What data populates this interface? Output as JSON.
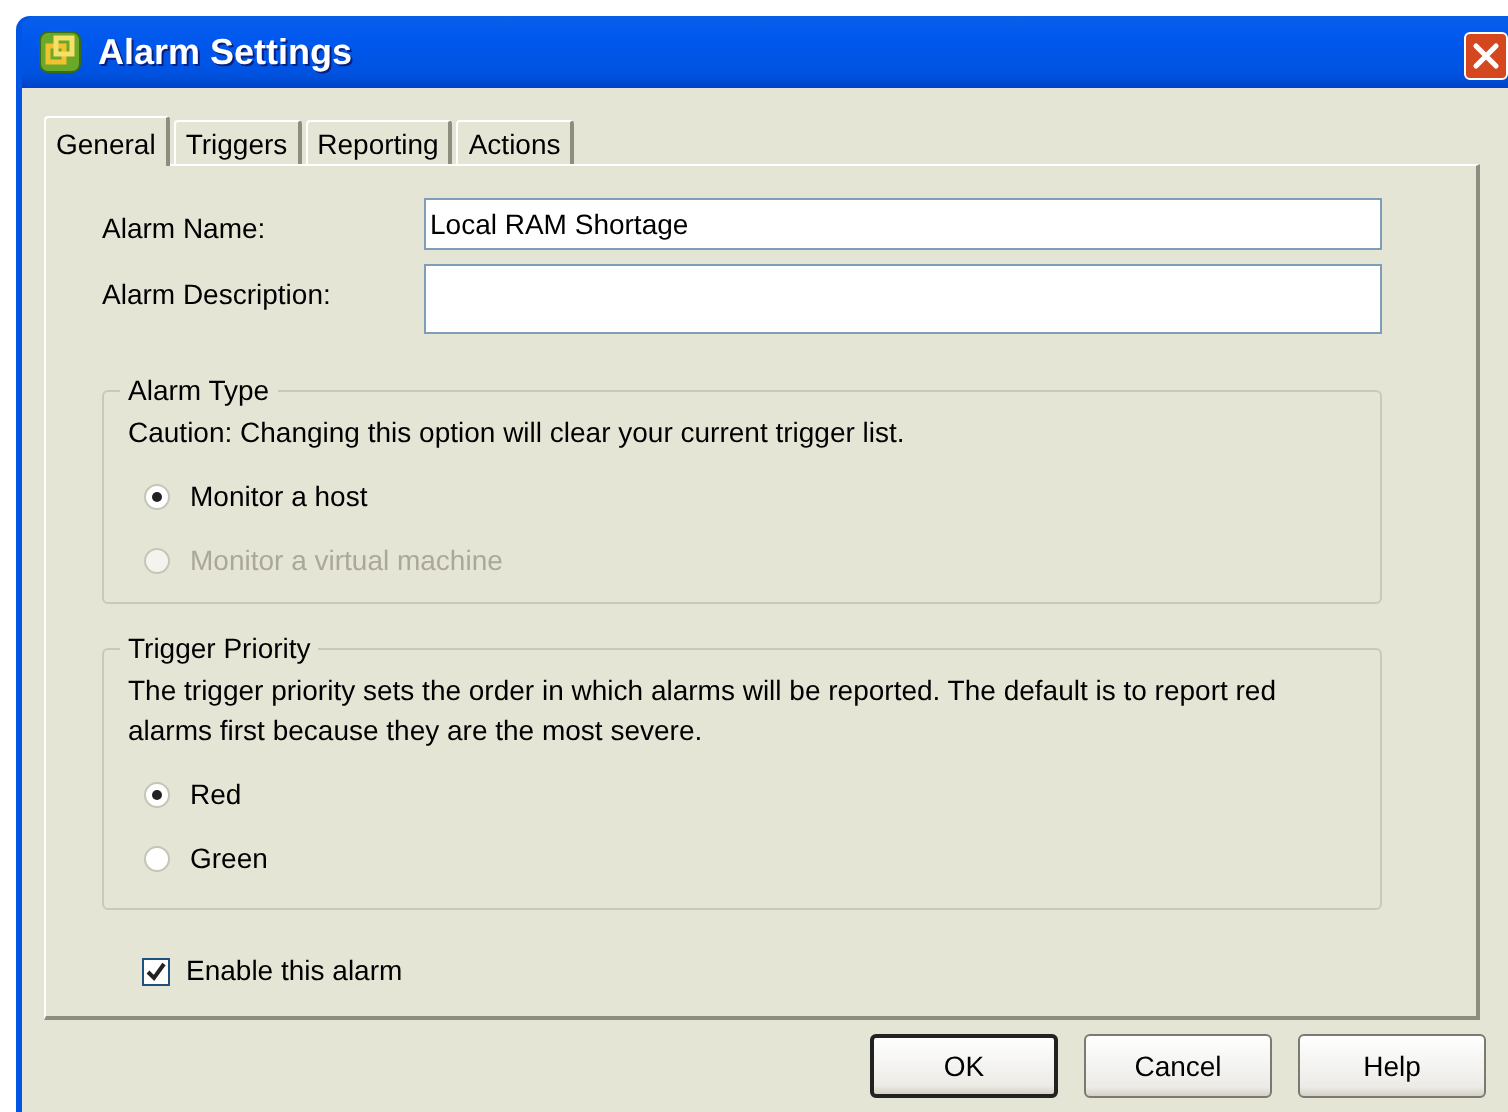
{
  "window": {
    "title": "Alarm Settings"
  },
  "tabs": [
    {
      "label": "General",
      "selected": true
    },
    {
      "label": "Triggers",
      "selected": false
    },
    {
      "label": "Reporting",
      "selected": false
    },
    {
      "label": "Actions",
      "selected": false
    }
  ],
  "fields": [
    {
      "label": "Alarm Name:",
      "value": "Local RAM Shortage",
      "kind": "single"
    },
    {
      "label": "Alarm Description:",
      "kind": "multi"
    }
  ],
  "alarm_type": {
    "legend": "Alarm Type",
    "text": "Caution: Changing this option will clear your current trigger list.",
    "options": [
      {
        "label": "Monitor a host",
        "selected": true,
        "disabled": false
      },
      {
        "label": "Monitor a virtual machine",
        "selected": false,
        "disabled": true
      }
    ]
  },
  "trigger_priority": {
    "legend": "Trigger Priority",
    "text": "The trigger priority sets the order in which alarms will be reported. The default is to report red alarms first because they are the most severe.",
    "options": [
      {
        "label": "Red",
        "selected": true,
        "disabled": false
      },
      {
        "label": "Green",
        "selected": false,
        "disabled": false
      }
    ]
  },
  "enable": {
    "label": "Enable this alarm",
    "checked": true
  },
  "buttons": [
    {
      "label": "OK",
      "default": true
    },
    {
      "label": "Cancel",
      "default": false
    },
    {
      "label": "Help",
      "default": false
    }
  ]
}
